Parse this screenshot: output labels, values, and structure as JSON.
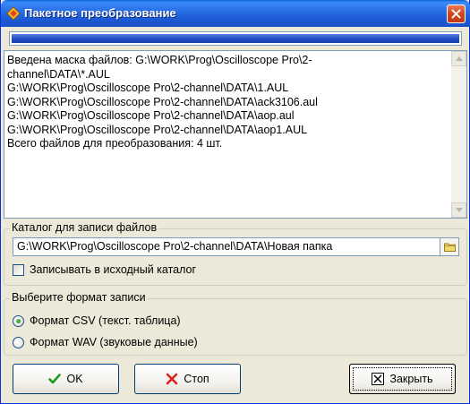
{
  "window": {
    "title": "Пакетное преобразование",
    "progress_fraction": 1.0
  },
  "log": {
    "lines": [
      "Введена маска файлов: G:\\WORK\\Prog\\Oscilloscope Pro\\2-",
      "channel\\DATA\\*.AUL",
      "G:\\WORK\\Prog\\Oscilloscope Pro\\2-channel\\DATA\\1.AUL",
      "G:\\WORK\\Prog\\Oscilloscope Pro\\2-channel\\DATA\\ack3106.aul",
      "G:\\WORK\\Prog\\Oscilloscope Pro\\2-channel\\DATA\\aop.aul",
      "G:\\WORK\\Prog\\Oscilloscope Pro\\2-channel\\DATA\\aop1.AUL",
      "Всего файлов для преобразования: 4 шт."
    ]
  },
  "output_folder": {
    "group_label": "Каталог для записи файлов",
    "path": "G:\\WORK\\Prog\\Oscilloscope Pro\\2-channel\\DATA\\Новая папка",
    "write_to_source_label": "Записывать в исходный каталог",
    "write_to_source_checked": false
  },
  "format": {
    "group_label": "Выберите формат записи",
    "options": [
      {
        "label": "Формат CSV (текст. таблица)",
        "checked": true
      },
      {
        "label": "Формат WAV (звуковые данные)",
        "checked": false
      }
    ]
  },
  "buttons": {
    "ok": "OK",
    "stop": "Стоп",
    "close": "Закрыть"
  },
  "icons": {
    "title": "app-diamond-icon",
    "ok": "green-check-icon",
    "stop": "red-x-icon",
    "close": "close-box-icon",
    "browse": "folder-icon"
  }
}
